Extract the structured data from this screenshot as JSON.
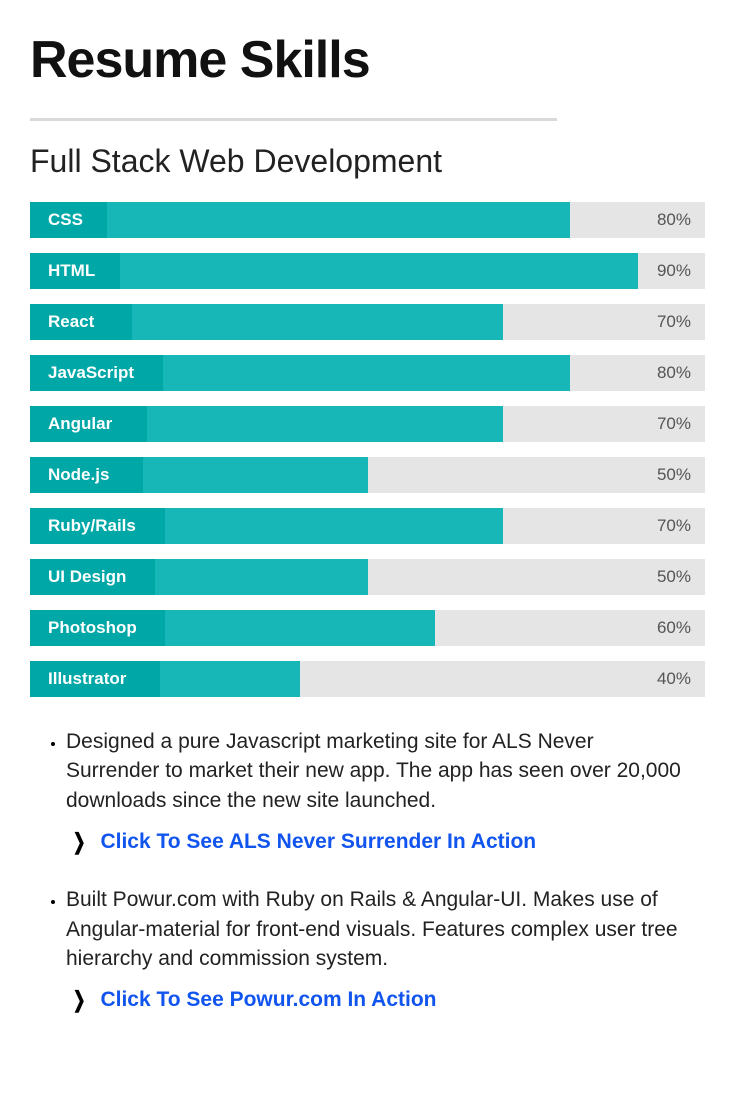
{
  "title": "Resume Skills",
  "subtitle": "Full Stack Web Development",
  "chart_data": {
    "type": "bar",
    "categories": [
      "CSS",
      "HTML",
      "React",
      "JavaScript",
      "Angular",
      "Node.js",
      "Ruby/Rails",
      "UI Design",
      "Photoshop",
      "Illustrator"
    ],
    "values": [
      80,
      90,
      70,
      80,
      70,
      50,
      70,
      50,
      60,
      40
    ],
    "labels": [
      "80%",
      "90%",
      "70%",
      "80%",
      "70%",
      "50%",
      "70%",
      "50%",
      "60%",
      "40%"
    ],
    "label_widths": [
      77,
      90,
      102,
      133,
      117,
      113,
      135,
      125,
      135,
      130
    ],
    "xlabel": "",
    "ylabel": "",
    "ylim": [
      0,
      100
    ]
  },
  "items": [
    {
      "text": "Designed a pure Javascript marketing site for ALS Never Surrender to market their new app. The app has seen over 20,000 downloads since the new site launched.",
      "link": "Click To See ALS Never Surrender In Action"
    },
    {
      "text": "Built Powur.com with Ruby on Rails & Angular-UI. Makes use of Angular-material for front-end visuals. Features complex user tree hierarchy and commission system.",
      "link": "Click To See Powur.com In Action"
    }
  ]
}
